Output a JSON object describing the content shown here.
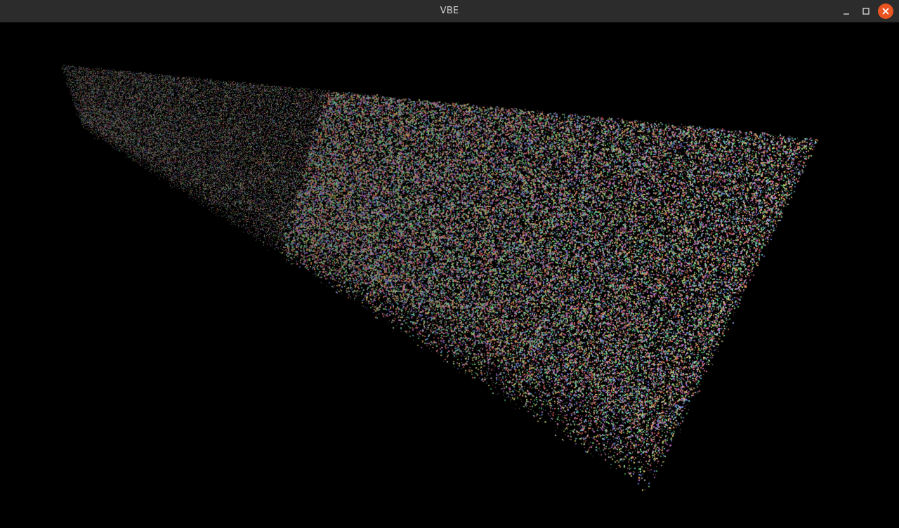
{
  "window": {
    "title": "VBE"
  },
  "controls": {
    "minimize_icon": "minimize-icon",
    "maximize_icon": "maximize-icon",
    "close_icon": "close-icon",
    "close_color": "#e95420",
    "icon_color": "#dddddd"
  },
  "scene": {
    "background": "#000000",
    "content": "point-cloud"
  }
}
